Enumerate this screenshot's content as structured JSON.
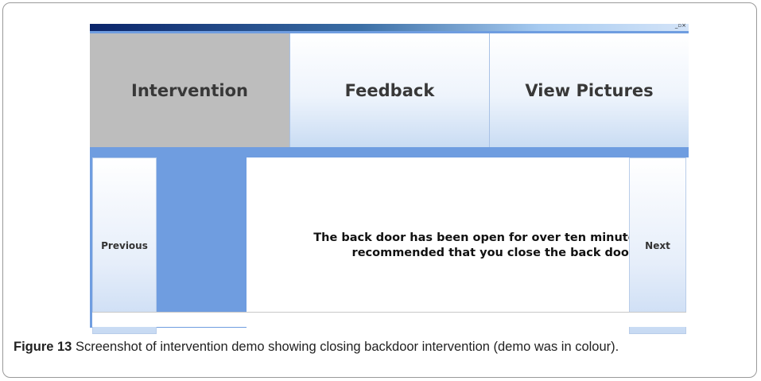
{
  "window": {
    "controls": "_▫×"
  },
  "tabs": [
    {
      "label": "Intervention",
      "active": true
    },
    {
      "label": "Feedback",
      "active": false
    },
    {
      "label": "View Pictures",
      "active": false
    }
  ],
  "nav": {
    "previous_label": "Previous",
    "next_label": "Next"
  },
  "message": "The back door has been open for over ten minutes. It is recommended that you close the back door.",
  "caption": {
    "figure_label": "Figure 13",
    "text": "Screenshot of intervention demo showing closing backdoor intervention (demo was in colour)."
  },
  "colors": {
    "active_tab": "#bdbdbd",
    "accent_border": "#6f9de0",
    "title_bar": "#0a246a"
  }
}
